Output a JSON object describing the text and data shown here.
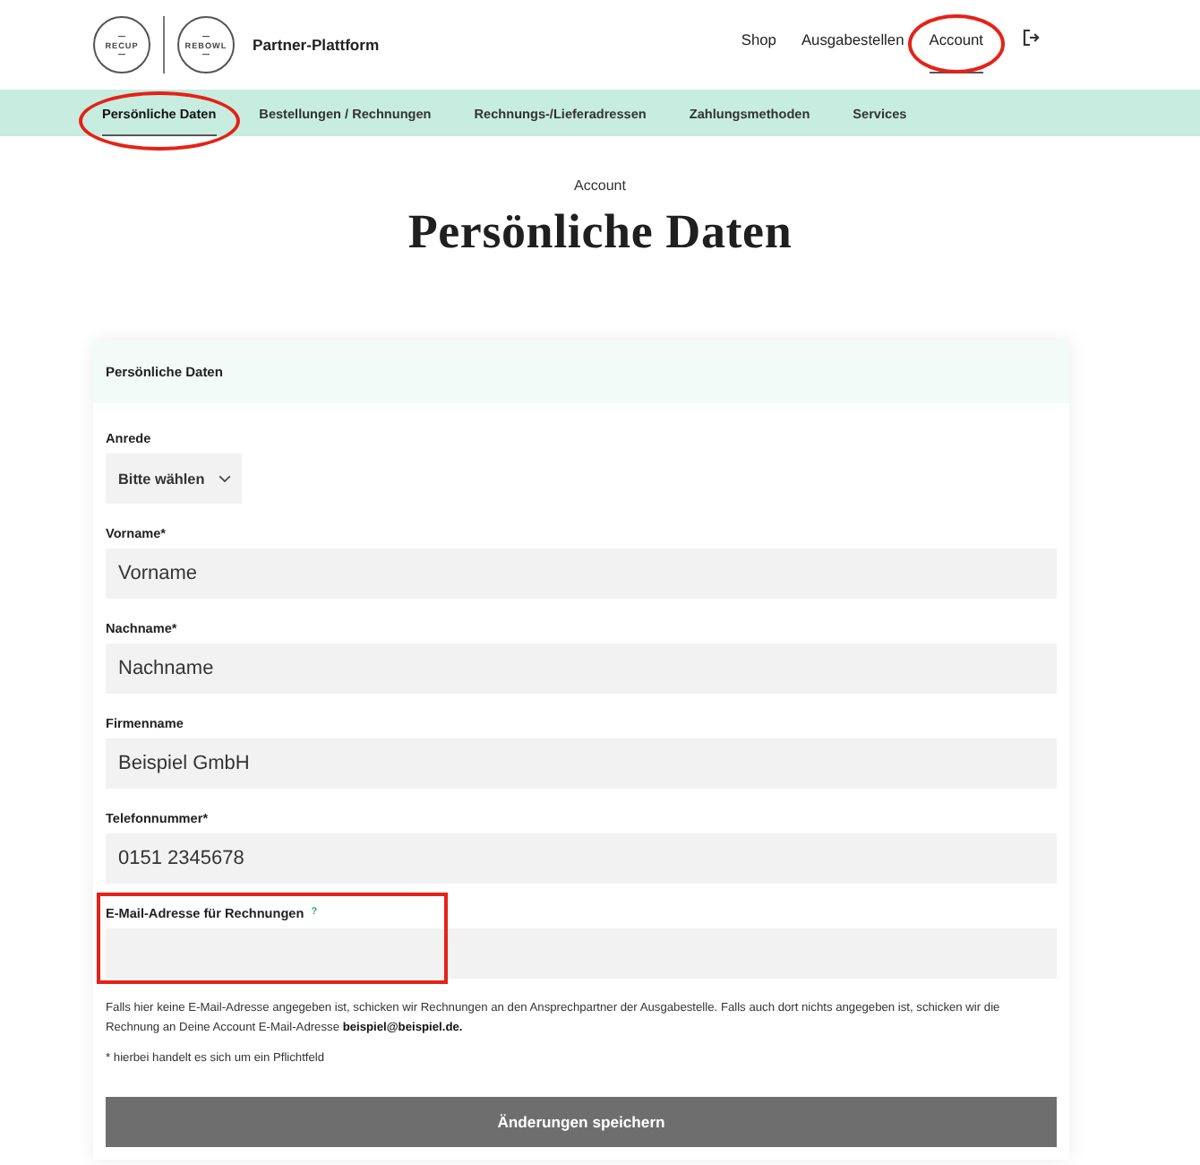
{
  "header": {
    "logos": [
      {
        "text": "RECUP"
      },
      {
        "text": "REBOWL"
      }
    ],
    "title": "Partner-Plattform",
    "nav": [
      {
        "label": "Shop",
        "selected": false,
        "circled": false
      },
      {
        "label": "Ausgabestellen",
        "selected": false,
        "circled": false
      },
      {
        "label": "Account",
        "selected": true,
        "circled": true
      }
    ]
  },
  "subnav": [
    {
      "label": "Persönliche Daten",
      "selected": true,
      "circled": true
    },
    {
      "label": "Bestellungen / Rechnungen",
      "selected": false,
      "circled": false
    },
    {
      "label": "Rechnungs-/Lieferadressen",
      "selected": false,
      "circled": false
    },
    {
      "label": "Zahlungsmethoden",
      "selected": false,
      "circled": false
    },
    {
      "label": "Services",
      "selected": false,
      "circled": false
    }
  ],
  "page": {
    "eyebrow": "Account",
    "title": "Persönliche Daten"
  },
  "card": {
    "title": "Persönliche Daten",
    "fields": [
      {
        "kind": "select",
        "label": "Anrede",
        "value": "Bitte wählen",
        "boxed": false
      },
      {
        "kind": "text",
        "label": "Vorname*",
        "value": "Vorname",
        "boxed": false
      },
      {
        "kind": "text",
        "label": "Nachname*",
        "value": "Nachname",
        "boxed": false
      },
      {
        "kind": "text",
        "label": "Firmenname",
        "value": "Beispiel GmbH",
        "boxed": false
      },
      {
        "kind": "text",
        "label": "Telefonnummer*",
        "value": "0151 2345678",
        "boxed": false
      },
      {
        "kind": "text",
        "label": "E-Mail-Adresse für Rechnungen",
        "help": "?",
        "boxed": true
      }
    ],
    "note": "Falls hier keine E-Mail-Adresse angegeben ist, schicken wir Rechnungen an den Ansprechpartner der Ausgabestelle. Falls auch dort nichts angegeben ist, schicken wir die Rechnung an Deine Account E-Mail-Adresse  **beispiel@beispiel.de.**",
    "required_note": "* hierbei handelt es sich um ein Pflichtfeld",
    "submit": "Änderungen speichern"
  }
}
